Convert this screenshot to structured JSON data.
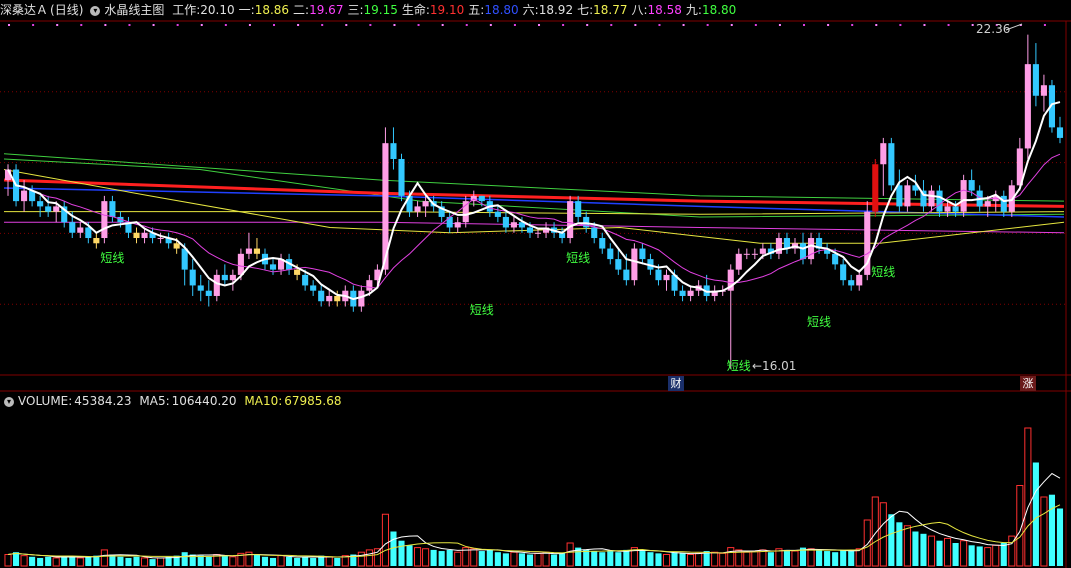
{
  "main_header": {
    "title": "深桑达Ａ",
    "period": "(日线)",
    "indicator": "水晶线主图",
    "items": [
      {
        "label": "工作:",
        "value": "20.10",
        "color": "#e0e0e0"
      },
      {
        "label": "一:",
        "value": "18.86",
        "color": "#f0f050"
      },
      {
        "label": "二:",
        "value": "19.67",
        "color": "#ff40ff"
      },
      {
        "label": "三:",
        "value": "19.15",
        "color": "#40ff40"
      },
      {
        "label": "生命:",
        "value": "19.10",
        "color": "#ff3030"
      },
      {
        "label": "五:",
        "value": "18.80",
        "color": "#3050ff"
      },
      {
        "label": "六:",
        "value": "18.92",
        "color": "#e0e0e0"
      },
      {
        "label": "七:",
        "value": "18.77",
        "color": "#f0f050"
      },
      {
        "label": "八:",
        "value": "18.58",
        "color": "#ff40ff"
      },
      {
        "label": "九:",
        "value": "18.80",
        "color": "#40ff40"
      }
    ]
  },
  "volume_header": {
    "label": "VOLUME:",
    "value": "45384.23",
    "ma5_label": "MA5:",
    "ma5": "106440.20",
    "ma10_label": "MA10:",
    "ma10": "67985.68"
  },
  "annotations": {
    "high": "22.36",
    "low": "16.01",
    "short_line": "短线",
    "fin_marker": "财",
    "rise_marker": "涨"
  },
  "colors": {
    "up_pink": "#ff9ee6",
    "down_blue": "#33c8ff",
    "weak_yellow": "#ffd966",
    "signal_red": "#e01010",
    "ma_white": "#ffffff",
    "ma_magenta": "#e040e0",
    "life_red": "#ff2020",
    "ma_blue": "#2040ff",
    "ma_green": "#40d040",
    "ma_yellow": "#e6e640",
    "vol_up": "#ff3030",
    "vol_down": "#40ffff",
    "grid": "#800000"
  },
  "chart_data": {
    "type": "candlestick",
    "price_high": 22.36,
    "price_low": 16.01,
    "candles": [
      [
        19.6,
        19.9,
        19.3,
        19.8
      ],
      [
        19.8,
        19.9,
        19.1,
        19.2
      ],
      [
        19.2,
        19.6,
        19.0,
        19.4
      ],
      [
        19.4,
        19.5,
        19.1,
        19.2
      ],
      [
        19.2,
        19.3,
        18.9,
        19.1
      ],
      [
        19.1,
        19.3,
        18.9,
        19.0
      ],
      [
        19.0,
        19.2,
        18.8,
        19.1
      ],
      [
        19.1,
        19.2,
        18.7,
        18.8
      ],
      [
        18.8,
        19.0,
        18.5,
        18.6
      ],
      [
        18.6,
        18.8,
        18.5,
        18.7
      ],
      [
        18.7,
        18.8,
        18.4,
        18.5
      ],
      [
        18.5,
        18.6,
        18.3,
        18.4
      ],
      [
        18.5,
        19.3,
        18.4,
        19.2
      ],
      [
        19.2,
        19.3,
        18.8,
        18.9
      ],
      [
        18.9,
        19.0,
        18.7,
        18.8
      ],
      [
        18.8,
        18.9,
        18.5,
        18.6
      ],
      [
        18.6,
        18.7,
        18.4,
        18.5
      ],
      [
        18.5,
        18.7,
        18.4,
        18.6
      ],
      [
        18.6,
        18.7,
        18.4,
        18.5
      ],
      [
        18.5,
        18.6,
        18.4,
        18.5
      ],
      [
        18.5,
        18.6,
        18.3,
        18.4
      ],
      [
        18.4,
        18.5,
        18.2,
        18.3
      ],
      [
        18.3,
        18.4,
        17.6,
        17.9
      ],
      [
        17.9,
        18.1,
        17.4,
        17.6
      ],
      [
        17.6,
        17.8,
        17.3,
        17.5
      ],
      [
        17.5,
        17.7,
        17.2,
        17.4
      ],
      [
        17.4,
        17.9,
        17.3,
        17.8
      ],
      [
        17.8,
        18.0,
        17.6,
        17.7
      ],
      [
        17.7,
        17.9,
        17.5,
        17.8
      ],
      [
        17.8,
        18.3,
        17.7,
        18.2
      ],
      [
        18.2,
        18.6,
        18.1,
        18.3
      ],
      [
        18.3,
        18.5,
        18.1,
        18.2
      ],
      [
        18.2,
        18.3,
        17.9,
        18.0
      ],
      [
        18.0,
        18.1,
        17.8,
        17.9
      ],
      [
        17.9,
        18.2,
        17.8,
        18.1
      ],
      [
        18.1,
        18.2,
        17.8,
        17.9
      ],
      [
        17.9,
        18.0,
        17.7,
        17.8
      ],
      [
        17.8,
        17.9,
        17.5,
        17.6
      ],
      [
        17.6,
        17.7,
        17.4,
        17.5
      ],
      [
        17.5,
        17.6,
        17.2,
        17.3
      ],
      [
        17.3,
        17.5,
        17.2,
        17.4
      ],
      [
        17.4,
        17.5,
        17.2,
        17.3
      ],
      [
        17.3,
        17.6,
        17.2,
        17.5
      ],
      [
        17.5,
        17.6,
        17.1,
        17.2
      ],
      [
        17.2,
        17.6,
        17.1,
        17.5
      ],
      [
        17.5,
        17.8,
        17.4,
        17.7
      ],
      [
        17.7,
        18.0,
        17.6,
        17.9
      ],
      [
        17.9,
        20.6,
        17.8,
        20.3
      ],
      [
        20.3,
        20.6,
        19.8,
        20.0
      ],
      [
        20.0,
        20.1,
        19.2,
        19.3
      ],
      [
        19.3,
        19.4,
        18.9,
        19.0
      ],
      [
        19.0,
        19.2,
        18.9,
        19.1
      ],
      [
        19.1,
        19.3,
        18.9,
        19.2
      ],
      [
        19.2,
        19.3,
        19.0,
        19.1
      ],
      [
        19.1,
        19.2,
        18.8,
        18.9
      ],
      [
        18.9,
        19.0,
        18.6,
        18.7
      ],
      [
        18.7,
        18.9,
        18.6,
        18.8
      ],
      [
        18.8,
        19.3,
        18.7,
        19.2
      ],
      [
        19.2,
        19.4,
        19.1,
        19.3
      ],
      [
        19.3,
        19.3,
        19.1,
        19.2
      ],
      [
        19.2,
        19.3,
        18.9,
        19.0
      ],
      [
        19.0,
        19.1,
        18.8,
        18.9
      ],
      [
        18.9,
        19.0,
        18.6,
        18.7
      ],
      [
        18.7,
        18.9,
        18.6,
        18.8
      ],
      [
        18.8,
        18.9,
        18.6,
        18.7
      ],
      [
        18.7,
        18.8,
        18.5,
        18.6
      ],
      [
        18.6,
        18.7,
        18.5,
        18.6
      ],
      [
        18.6,
        18.8,
        18.5,
        18.7
      ],
      [
        18.7,
        18.8,
        18.5,
        18.6
      ],
      [
        18.6,
        18.7,
        18.4,
        18.5
      ],
      [
        18.5,
        19.3,
        18.4,
        19.2
      ],
      [
        19.2,
        19.3,
        18.8,
        18.9
      ],
      [
        18.9,
        19.0,
        18.6,
        18.7
      ],
      [
        18.7,
        18.8,
        18.4,
        18.5
      ],
      [
        18.5,
        18.6,
        18.2,
        18.3
      ],
      [
        18.3,
        18.4,
        18.0,
        18.1
      ],
      [
        18.1,
        18.3,
        17.8,
        17.9
      ],
      [
        17.9,
        18.2,
        17.6,
        17.7
      ],
      [
        17.7,
        18.4,
        17.6,
        18.3
      ],
      [
        18.3,
        18.4,
        18.0,
        18.1
      ],
      [
        18.1,
        18.2,
        17.8,
        17.9
      ],
      [
        17.9,
        18.0,
        17.6,
        17.7
      ],
      [
        17.7,
        17.9,
        17.5,
        17.8
      ],
      [
        17.8,
        17.9,
        17.4,
        17.5
      ],
      [
        17.5,
        17.6,
        17.3,
        17.4
      ],
      [
        17.4,
        17.6,
        17.3,
        17.5
      ],
      [
        17.5,
        17.7,
        17.4,
        17.6
      ],
      [
        17.6,
        17.8,
        17.3,
        17.4
      ],
      [
        17.4,
        17.6,
        17.3,
        17.5
      ],
      [
        17.5,
        17.6,
        17.4,
        17.5
      ],
      [
        17.5,
        18.0,
        16.01,
        17.9
      ],
      [
        17.9,
        18.3,
        17.8,
        18.2
      ],
      [
        18.2,
        18.3,
        18.1,
        18.2
      ],
      [
        18.2,
        18.3,
        18.1,
        18.2
      ],
      [
        18.2,
        18.4,
        18.1,
        18.3
      ],
      [
        18.3,
        18.4,
        18.1,
        18.2
      ],
      [
        18.2,
        18.6,
        18.1,
        18.5
      ],
      [
        18.5,
        18.6,
        18.2,
        18.3
      ],
      [
        18.3,
        18.5,
        18.2,
        18.4
      ],
      [
        18.4,
        18.6,
        18.0,
        18.1
      ],
      [
        18.1,
        18.6,
        18.0,
        18.5
      ],
      [
        18.5,
        18.6,
        18.2,
        18.3
      ],
      [
        18.3,
        18.4,
        18.1,
        18.2
      ],
      [
        18.2,
        18.3,
        17.9,
        18.0
      ],
      [
        18.0,
        18.1,
        17.6,
        17.7
      ],
      [
        17.7,
        17.8,
        17.5,
        17.6
      ],
      [
        17.6,
        17.9,
        17.5,
        17.8
      ],
      [
        17.8,
        19.2,
        17.7,
        19.0
      ],
      [
        19.0,
        20.0,
        18.9,
        19.9
      ],
      [
        19.9,
        20.4,
        19.3,
        20.3
      ],
      [
        20.3,
        20.4,
        19.4,
        19.5
      ],
      [
        19.5,
        19.8,
        19.0,
        19.1
      ],
      [
        19.1,
        19.6,
        19.0,
        19.5
      ],
      [
        19.5,
        19.7,
        19.3,
        19.4
      ],
      [
        19.4,
        19.6,
        19.0,
        19.1
      ],
      [
        19.1,
        19.5,
        19.0,
        19.4
      ],
      [
        19.4,
        19.5,
        18.9,
        19.0
      ],
      [
        19.0,
        19.2,
        18.9,
        19.1
      ],
      [
        19.1,
        19.2,
        18.9,
        19.0
      ],
      [
        19.0,
        19.7,
        18.9,
        19.6
      ],
      [
        19.6,
        19.8,
        19.3,
        19.4
      ],
      [
        19.4,
        19.5,
        19.0,
        19.1
      ],
      [
        19.1,
        19.3,
        18.9,
        19.2
      ],
      [
        19.2,
        19.4,
        19.0,
        19.3
      ],
      [
        19.3,
        19.4,
        18.9,
        19.0
      ],
      [
        19.0,
        19.6,
        18.9,
        19.5
      ],
      [
        19.5,
        20.4,
        19.4,
        20.2
      ],
      [
        20.2,
        22.36,
        20.0,
        21.8
      ],
      [
        21.8,
        22.2,
        21.0,
        21.2
      ],
      [
        21.2,
        21.6,
        20.9,
        21.4
      ],
      [
        21.4,
        21.5,
        20.5,
        20.6
      ],
      [
        20.6,
        20.8,
        20.3,
        20.4
      ]
    ],
    "volume": [
      10,
      12,
      9,
      8,
      7,
      8,
      7,
      9,
      8,
      7,
      8,
      9,
      14,
      10,
      8,
      7,
      8,
      7,
      6,
      7,
      8,
      9,
      12,
      10,
      9,
      8,
      10,
      9,
      8,
      11,
      12,
      10,
      8,
      7,
      9,
      8,
      7,
      8,
      7,
      9,
      8,
      7,
      9,
      10,
      12,
      14,
      15,
      45,
      30,
      22,
      18,
      16,
      15,
      14,
      13,
      14,
      12,
      16,
      15,
      13,
      14,
      12,
      11,
      12,
      11,
      10,
      11,
      12,
      10,
      11,
      20,
      16,
      14,
      13,
      12,
      13,
      12,
      14,
      16,
      13,
      12,
      11,
      10,
      12,
      11,
      10,
      11,
      13,
      12,
      11,
      16,
      14,
      12,
      13,
      14,
      12,
      15,
      14,
      13,
      16,
      15,
      14,
      13,
      12,
      14,
      13,
      15,
      40,
      60,
      55,
      45,
      38,
      35,
      30,
      28,
      26,
      22,
      24,
      20,
      22,
      18,
      17,
      16,
      18,
      20,
      26,
      70,
      120,
      90,
      60,
      62,
      50
    ],
    "vol_max": 140
  }
}
